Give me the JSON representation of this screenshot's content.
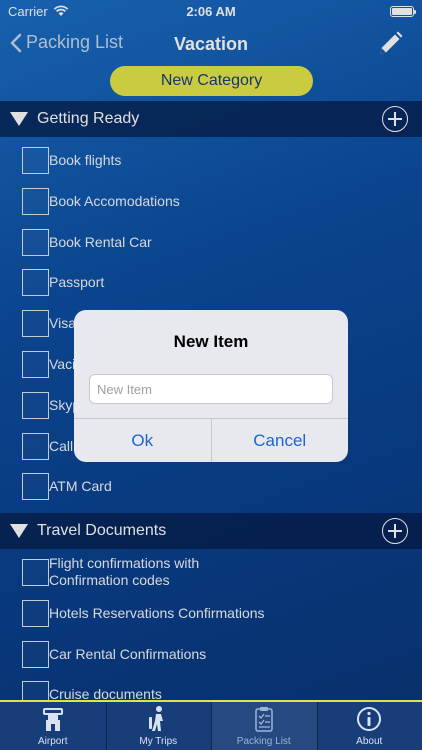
{
  "status_bar": {
    "carrier": "Carrier",
    "time": "2:06 AM"
  },
  "nav": {
    "back_label": "Packing List",
    "title": "Vacation"
  },
  "new_category_label": "New Category",
  "sections": [
    {
      "title": "Getting Ready",
      "items": [
        {
          "label": "Book flights"
        },
        {
          "label": "Book Accomodations"
        },
        {
          "label": "Book Rental Car"
        },
        {
          "label": "Passport"
        },
        {
          "label": "Visa"
        },
        {
          "label": "Vaci"
        },
        {
          "label": "Skyp"
        },
        {
          "label": "Calli"
        },
        {
          "label": "ATM Card"
        }
      ]
    },
    {
      "title": "Travel Documents",
      "items": [
        {
          "label": "Flight confirmations with\nConfirmation codes"
        },
        {
          "label": "Hotels Reservations Confirmations"
        },
        {
          "label": "Car Rental Confirmations"
        },
        {
          "label": "Cruise documents"
        }
      ]
    }
  ],
  "dialog": {
    "title": "New Item",
    "input_placeholder": "New Item",
    "ok_label": "Ok",
    "cancel_label": "Cancel"
  },
  "tabs": [
    {
      "label": "Airport",
      "icon": "airport-tower-icon"
    },
    {
      "label": "My Trips",
      "icon": "traveler-icon"
    },
    {
      "label": "Packing List",
      "icon": "checklist-icon",
      "active": true
    },
    {
      "label": "About",
      "icon": "info-icon"
    }
  ],
  "colors": {
    "accent_yellow": "#e6e84a",
    "background_blue": "#0d4fa3",
    "dialog_button": "#1f63cf"
  }
}
